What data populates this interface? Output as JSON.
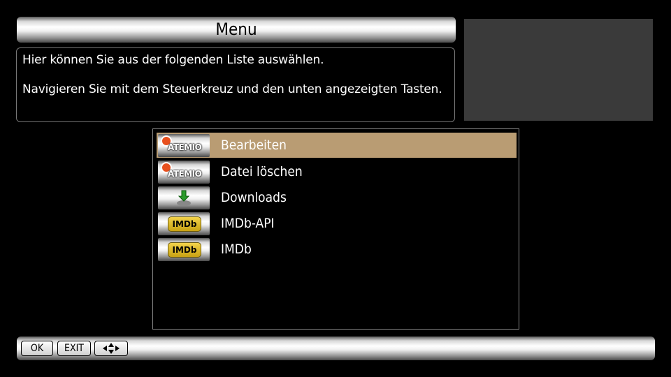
{
  "header": {
    "title": "Menu"
  },
  "info": {
    "line1": "Hier können Sie aus der folgenden Liste auswählen.",
    "line2": "Navigieren Sie mit dem Steuerkreuz und den unten angezeigten Tasten."
  },
  "list": {
    "items": [
      {
        "label": "Bearbeiten",
        "icon": "atemio-icon",
        "thumb_text": "ATEMIO",
        "selected": true
      },
      {
        "label": "Datei löschen",
        "icon": "atemio-icon",
        "thumb_text": "ATEMIO",
        "selected": false
      },
      {
        "label": "Downloads",
        "icon": "download-icon",
        "thumb_text": "",
        "selected": false
      },
      {
        "label": "IMDb-API",
        "icon": "imdb-icon",
        "thumb_text": "IMDb",
        "selected": false
      },
      {
        "label": "IMDb",
        "icon": "imdb-icon",
        "thumb_text": "IMDb",
        "selected": false
      }
    ]
  },
  "footer": {
    "ok_label": "OK",
    "exit_label": "EXIT",
    "nav_icon": "dpad-arrows-icon"
  },
  "colors": {
    "selection": "#b99c73",
    "preview_bg": "#3a3a3a"
  }
}
